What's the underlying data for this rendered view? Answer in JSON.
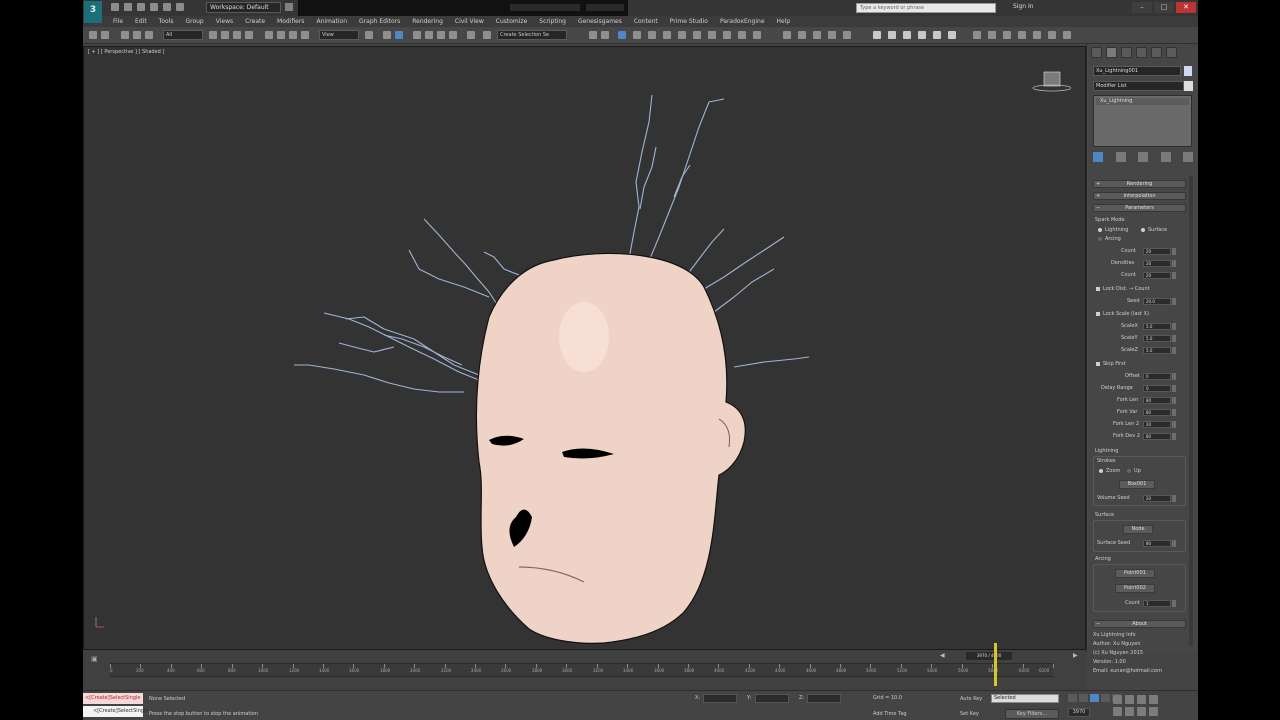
{
  "window": {
    "logo": "3",
    "workspace": "Workspace: Default",
    "search_placeholder": "Type a keyword or phrase",
    "sign_in": "Sign In",
    "minimize": "–",
    "maximize": "□",
    "close": "✕"
  },
  "menu": [
    "File",
    "Edit",
    "Tools",
    "Group",
    "Views",
    "Create",
    "Modifiers",
    "Animation",
    "Graph Editors",
    "Rendering",
    "Civil View",
    "Customize",
    "Scripting",
    "Genesisgames",
    "Content",
    "Prime Studio",
    "ParadoxEngine",
    "Help"
  ],
  "toolbar": {
    "selection_filter": "All",
    "ref_coord": "View",
    "named_sel": "Create Selection Se"
  },
  "viewport": {
    "label": "[ + ] [ Perspective ] [ Shaded ]"
  },
  "command_panel": {
    "object_name": "Xu_Lightning001",
    "modifier_list": "Modifier List",
    "stack_item": "Xu_Lightning",
    "rollouts": {
      "rendering": "Rendering",
      "interpolation": "Interpolation",
      "parameters": "Parameters",
      "about": "About"
    },
    "spark_mode": {
      "label": "Spark Mode",
      "lightning": "Lightning",
      "surface": "Surface",
      "arcing": "Arcing"
    },
    "params": [
      {
        "label": "Count",
        "value": "20"
      },
      {
        "label": "Densities",
        "value": "20"
      },
      {
        "label": "Count",
        "value": "20"
      }
    ],
    "lock_dist": {
      "label": "Lock Dist. → Count",
      "seed_label": "Seed",
      "seed": "20.0"
    },
    "lock_scale": {
      "label": "Lock Scale (last X)",
      "rows": [
        {
          "label": "ScaleX",
          "value": "5.0"
        },
        {
          "label": "ScaleY",
          "value": "5.0"
        },
        {
          "label": "ScaleZ",
          "value": "5.0"
        }
      ]
    },
    "skip_first": {
      "label": "Skip First",
      "rows": [
        {
          "label": "Offset",
          "value": "0"
        },
        {
          "label": "Delay Range",
          "value": "0"
        },
        {
          "label": "Fork Len",
          "value": "80"
        },
        {
          "label": "Fork Var",
          "value": "80"
        },
        {
          "label": "Fork Len 2",
          "value": "20"
        },
        {
          "label": "Fork Dev 2",
          "value": "80"
        }
      ]
    },
    "lightning": {
      "title": "Lightning",
      "strokes": "Strokes",
      "zoom": "Zoom",
      "up": "Up",
      "box_btn": "Box001",
      "volume_seed_label": "Volume Seed",
      "volume_seed": "20"
    },
    "surface": {
      "title": "Surface",
      "node_btn": "Node",
      "seed_label": "Surface Seed",
      "seed": "80"
    },
    "arcing": {
      "title": "Arcing",
      "point1": "Point001",
      "point2": "Point002",
      "count_label": "Count",
      "count": "1"
    },
    "about": [
      "Xu Lightning Info",
      "Author: Xu Nguyen",
      "(c) Xu Nguyen 2015",
      "Version: 1.00",
      "Email: xunan@hotmail.com"
    ]
  },
  "timeline": {
    "frame_display": "3970 / 4000",
    "ticks": [
      "0",
      "200",
      "400",
      "600",
      "800",
      "1000",
      "1200",
      "1400",
      "1600",
      "1800",
      "2000",
      "2200",
      "2400",
      "2600",
      "2800",
      "3000",
      "3200",
      "3400",
      "3600",
      "3800",
      "4000",
      "4200",
      "4400",
      "4600",
      "4800",
      "5000",
      "5200",
      "5400",
      "5600",
      "5800",
      "6000",
      "6200"
    ],
    "position_fraction": 0.9925
  },
  "status": {
    "maxscript_top": "<[Create]SelectSingle",
    "maxscript_bottom": "<[Create]SelectSingle",
    "selection": "None Selected",
    "prompt": "Press the stop button to stop the animation",
    "x_label": "X:",
    "y_label": "Y:",
    "z_label": "Z:",
    "grid": "Grid = 10.0",
    "add_time_tag": "Add Time Tag",
    "auto_key": "Auto Key",
    "set_key": "Set Key",
    "selected": "Selected",
    "key_filters": "Key Filters...",
    "frame": "3970"
  },
  "colors": {
    "viewport_bg": "#333333",
    "head_skin": "#f0d3c7",
    "lightning": "#9fb4d6",
    "timeline_cursor": "#d9c42b",
    "accent_blue": "#4d87c6"
  }
}
